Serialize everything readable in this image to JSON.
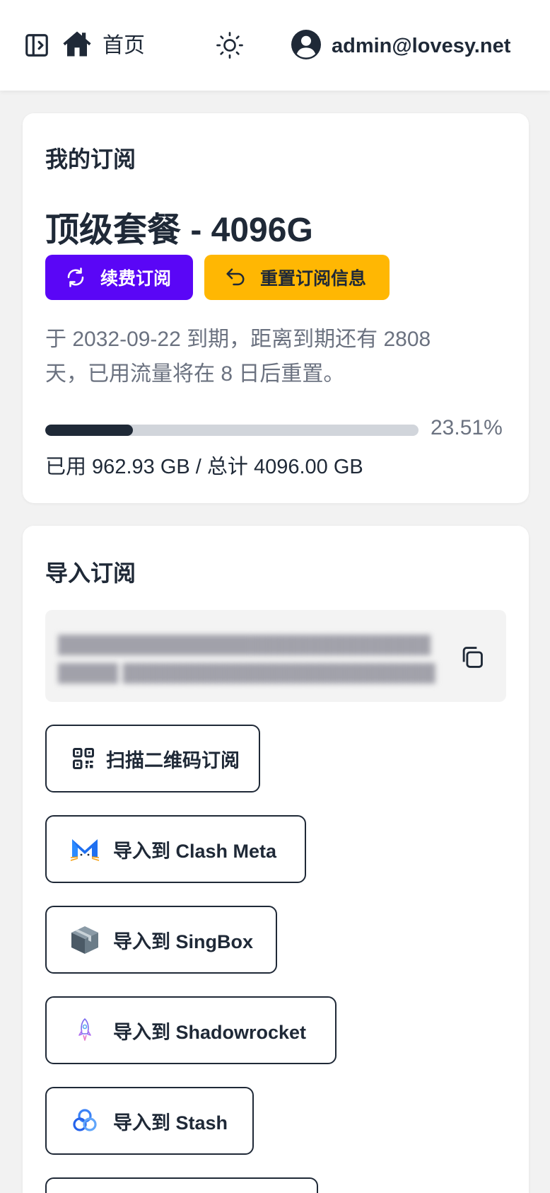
{
  "navbar": {
    "home_label": "首页",
    "user_email": "admin@lovesy.net"
  },
  "subscription": {
    "section_title": "我的订阅",
    "plan_name": "顶级套餐 - 4096G",
    "renew_label": "续费订阅",
    "reset_label": "重置订阅信息",
    "expiry_text": "于 2032-09-22 到期，距离到期还有 2808 天，已用流量将在 8 日后重置。",
    "usage_fraction": 0.2351,
    "usage_percent": "23.51%",
    "usage_text": "已用 962.93 GB / 总计 4096.00 GB"
  },
  "import": {
    "section_title": "导入订阅",
    "buttons": [
      {
        "label": "扫描二维码订阅",
        "icon": "qr-code-icon"
      },
      {
        "label": "导入到 Clash Meta",
        "icon": "clash-meta-icon"
      },
      {
        "label": "导入到 SingBox",
        "icon": "singbox-icon"
      },
      {
        "label": "导入到 Shadowrocket",
        "icon": "shadowrocket-icon"
      },
      {
        "label": "导入到 Stash",
        "icon": "stash-icon"
      }
    ]
  },
  "colors": {
    "renew_button": "#5a06f6",
    "reset_button": "#ffb703",
    "progress_fill": "#1f2937"
  }
}
